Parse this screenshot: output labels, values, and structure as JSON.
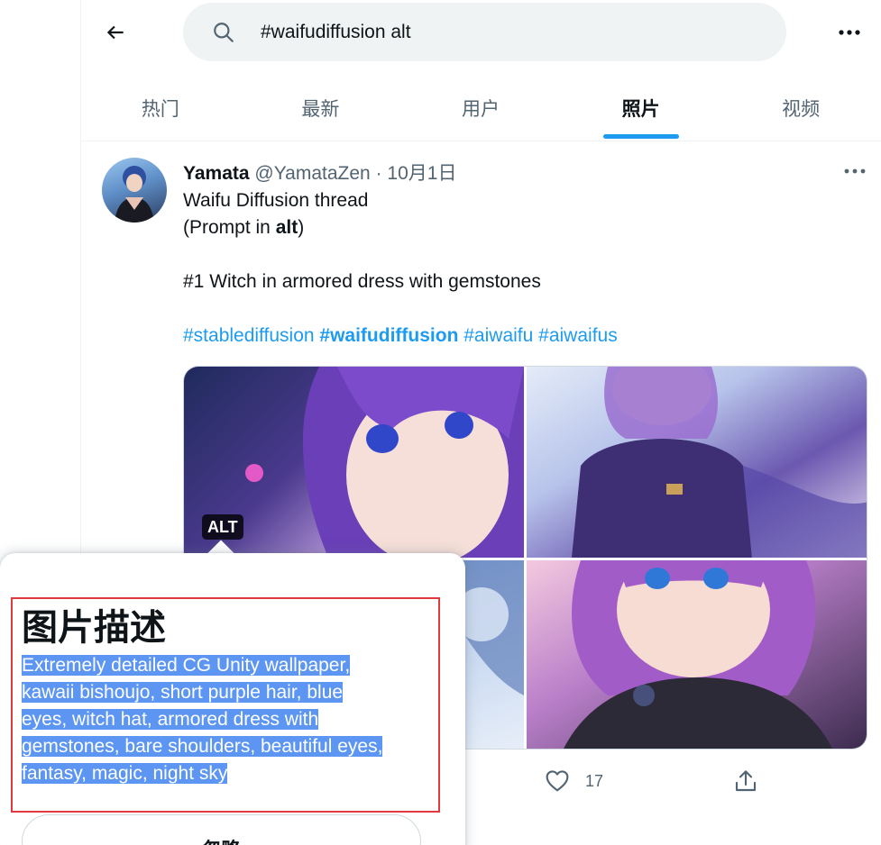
{
  "search": {
    "back_icon": "arrow-left-icon",
    "search_icon": "magnifier-icon",
    "query": "#waifudiffusion alt",
    "more_icon": "ellipsis-icon"
  },
  "tabs": [
    {
      "label": "热门",
      "active": false
    },
    {
      "label": "最新",
      "active": false
    },
    {
      "label": "用户",
      "active": false
    },
    {
      "label": "照片",
      "active": true
    },
    {
      "label": "视频",
      "active": false
    }
  ],
  "accent_color": "#1d9bf0",
  "tweet": {
    "author_name": "Yamata",
    "author_handle": "@YamataZen",
    "separator": "·",
    "date": "10月1日",
    "line1": "Waifu Diffusion thread",
    "line2_prefix": "(Prompt in ",
    "line2_bold": "alt",
    "line2_suffix": ")",
    "line3": "#1 Witch in armored dress with gemstones",
    "hashtags": [
      "#stablediffusion",
      "#waifudiffusion",
      "#aiwaifu",
      "#aiwaifus"
    ],
    "alt_badge": "ALT",
    "like_count": "17"
  },
  "alt_popover": {
    "title": "图片描述",
    "description_lines": [
      "Extremely detailed CG Unity wallpaper,",
      "kawaii bishoujo, short purple hair, blue",
      "eyes, witch hat, armored dress with",
      "gemstones, bare shoulders, beautiful eyes,",
      "fantasy, magic, night sky"
    ],
    "dismiss_label": "忽略",
    "highlight_color": "#e0393e",
    "selection_color": "#5c95f2"
  }
}
